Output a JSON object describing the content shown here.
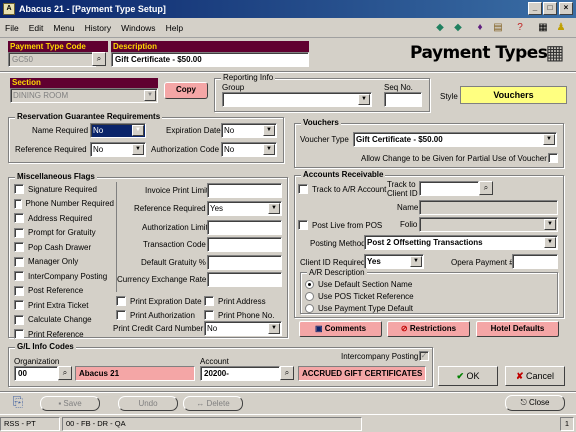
{
  "window": {
    "title": "Abacus 21 - [Payment Type Setup]",
    "min": "_",
    "max": "□",
    "close": "×"
  },
  "menu": [
    "File",
    "Edit",
    "Menu",
    "History",
    "Windows",
    "Help"
  ],
  "header": {
    "code_label": "Payment Type Code",
    "code_value": "GC50",
    "desc_label": "Description",
    "desc_value": "Gift Certificate - $50.00",
    "page_title": "Payment Types"
  },
  "section": {
    "label": "Section",
    "value": "DINING ROOM",
    "copy": "Copy"
  },
  "reporting": {
    "label": "Reporting Info",
    "group_label": "Group",
    "group_value": "",
    "seq_label": "Seq No.",
    "seq_value": "",
    "style_label": "Style",
    "style_value": "Vouchers"
  },
  "rgr": {
    "title": "Reservation Guarantee Requirements",
    "name_req_label": "Name Required",
    "name_req": "No",
    "exp_label": "Expiration Date",
    "exp": "No",
    "ref_req_label": "Reference Required",
    "ref_req": "No",
    "auth_label": "Authorization Code",
    "auth": "No"
  },
  "misc": {
    "title": "Miscellaneous Flags",
    "flags": [
      "Signature Required",
      "Phone Number Required",
      "Address Required",
      "Prompt for Gratuity",
      "Pop Cash Drawer",
      "Manager Only",
      "InterCompany Posting",
      "Post Reference",
      "Print Extra Ticket",
      "Calculate Change",
      "Print Reference"
    ],
    "invoice_limit_label": "Invoice Print Limit",
    "invoice_limit": "",
    "ref_req_label": "Reference Required",
    "ref_req": "Yes",
    "auth_limit_label": "Authorization Limit",
    "auth_limit": "",
    "trans_code_label": "Transaction Code",
    "trans_code": "",
    "def_grat_label": "Default Gratuity %",
    "def_grat": "",
    "curr_rate_label": "Currency Exchange Rate",
    "curr_rate": "",
    "print_flags": [
      "Print Expration Date",
      "Print Address",
      "Print Authorization",
      "Print Phone No."
    ],
    "print_cc_label": "Print Credit Card Number",
    "print_cc": "No"
  },
  "vouchers": {
    "title": "Vouchers",
    "type_label": "Voucher Type",
    "type_value": "Gift Certificate - $50.00",
    "allow_change": "Allow Change to be Given for Partial Use of Voucher"
  },
  "ar": {
    "title": "Accounts Receivable",
    "track_ar": "Track to A/R Account",
    "track_client_label": "Track to Client ID",
    "name_label": "Name",
    "post_live": "Post Live from POS",
    "folio_label": "Folio",
    "posting_method_label": "Posting Method",
    "posting_method": "Post 2 Offsetting Transactions",
    "client_id_req_label": "Client ID Required",
    "client_id_req": "Yes",
    "opera_label": "Opera Payment #",
    "desc_title": "A/R Description",
    "desc_options": [
      "Use Default Section Name",
      "Use POS Ticket Reference",
      "Use Payment Type Default"
    ]
  },
  "actions": {
    "comments": "Comments",
    "restrictions": "Restrictions",
    "hotel": "Hotel Defaults"
  },
  "gl": {
    "title": "G/L Info Codes",
    "org_label": "Organization",
    "org_code": "00",
    "org_name": "Abacus 21",
    "acct_label": "Account",
    "acct_code": "20200-",
    "acct_name": "ACCRUED GIFT CERTIFICATES",
    "interco_label": "Intercompany Posting"
  },
  "buttons": {
    "ok": "OK",
    "cancel": "Cancel",
    "save": "Save",
    "undo": "Undo",
    "delete": "Delete",
    "close": "Close"
  },
  "status": [
    "RSS - PT",
    "00 - FB - DR - QA"
  ],
  "page_num": "1"
}
